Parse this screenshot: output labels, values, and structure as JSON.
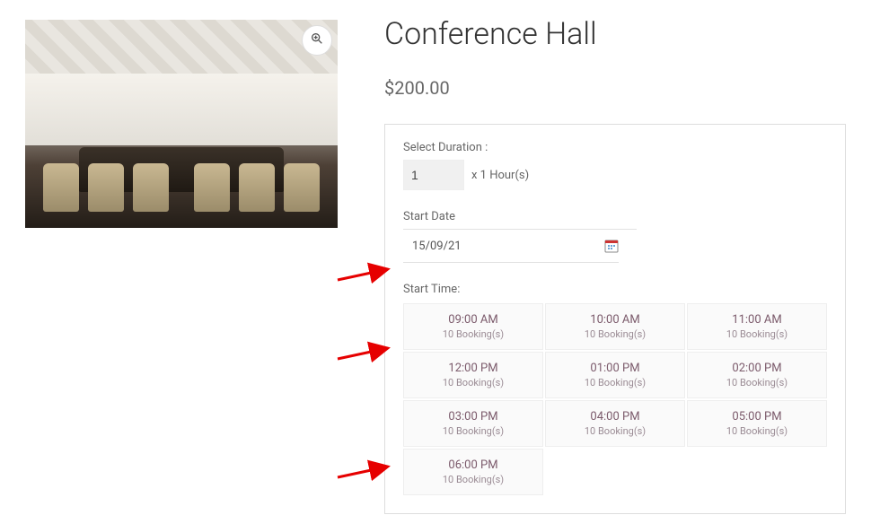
{
  "product": {
    "title": "Conference Hall",
    "price": "$200.00"
  },
  "duration": {
    "label": "Select Duration :",
    "value": "1",
    "suffix": "x 1 Hour(s)"
  },
  "start_date": {
    "label": "Start Date",
    "value": "15/09/21"
  },
  "start_time": {
    "label": "Start Time:",
    "slots": [
      {
        "time": "09:00 AM",
        "count": "10 Booking(s)"
      },
      {
        "time": "10:00 AM",
        "count": "10 Booking(s)"
      },
      {
        "time": "11:00 AM",
        "count": "10 Booking(s)"
      },
      {
        "time": "12:00 PM",
        "count": "10 Booking(s)"
      },
      {
        "time": "01:00 PM",
        "count": "10 Booking(s)"
      },
      {
        "time": "02:00 PM",
        "count": "10 Booking(s)"
      },
      {
        "time": "03:00 PM",
        "count": "10 Booking(s)"
      },
      {
        "time": "04:00 PM",
        "count": "10 Booking(s)"
      },
      {
        "time": "05:00 PM",
        "count": "10 Booking(s)"
      },
      {
        "time": "06:00 PM",
        "count": "10 Booking(s)"
      }
    ]
  },
  "icons": {
    "zoom": "magnifier-icon",
    "calendar": "calendar-icon"
  }
}
